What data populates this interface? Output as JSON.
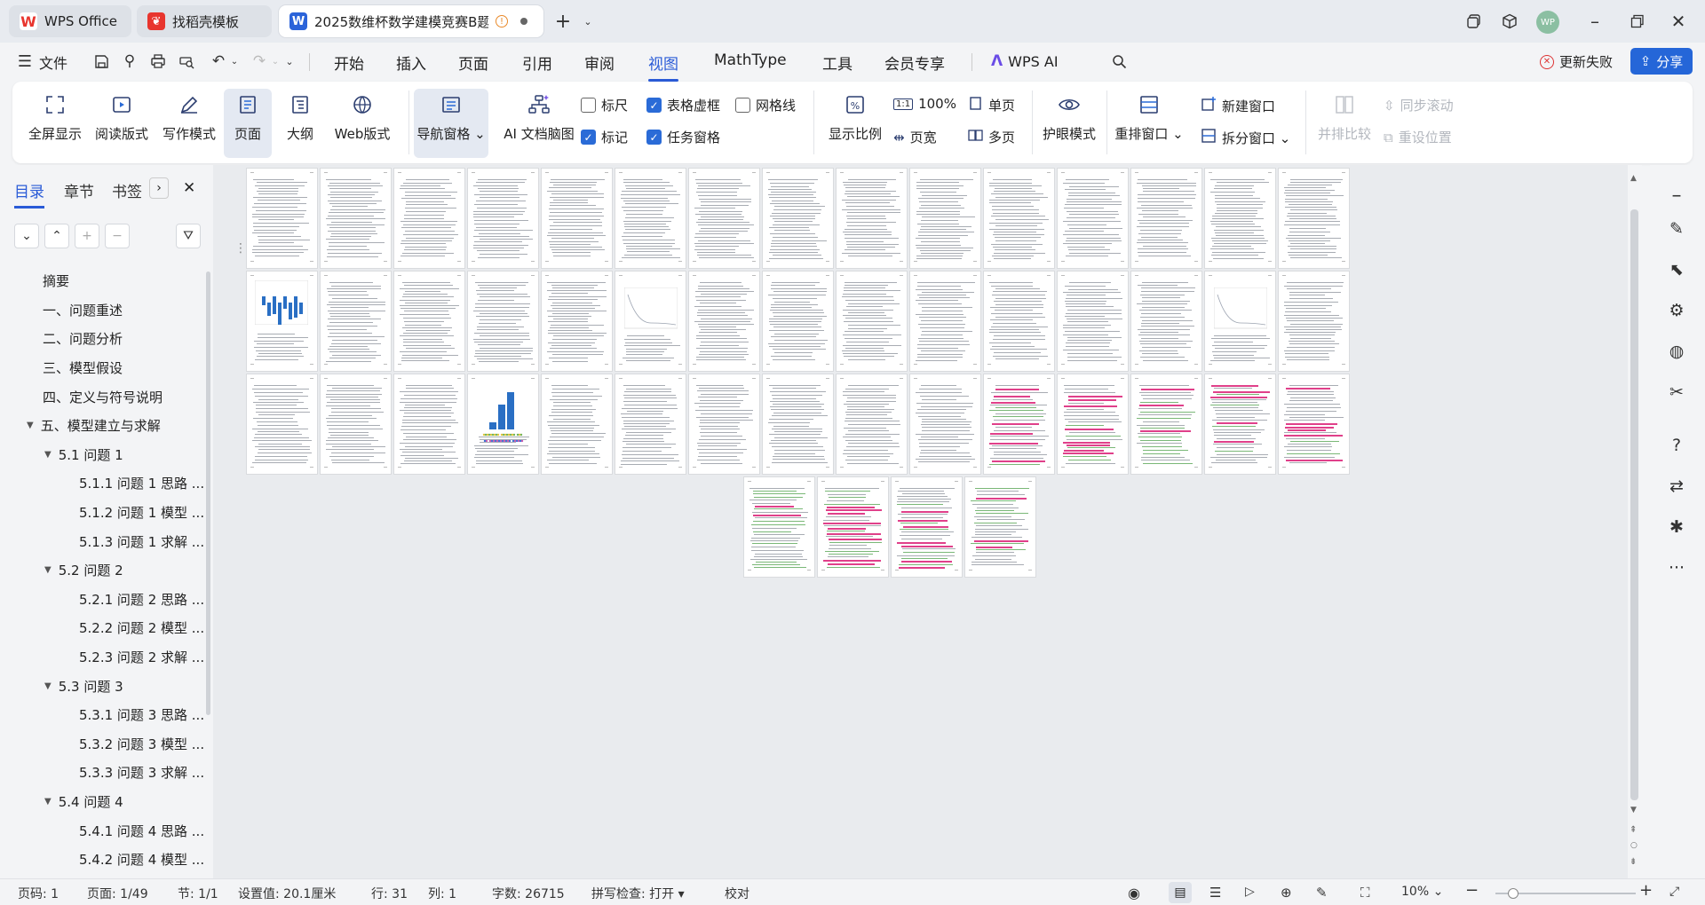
{
  "tabs": {
    "wps_office": "WPS Office",
    "template": "找稻壳模板",
    "document": "2025数维杯数学建模竞赛B题",
    "avatar": "WP"
  },
  "menu": {
    "file": "文件",
    "items": [
      "开始",
      "插入",
      "页面",
      "引用",
      "审阅",
      "视图",
      "MathType",
      "工具",
      "会员专享"
    ],
    "wps_ai": "WPS AI",
    "update_failed": "更新失败",
    "share": "分享"
  },
  "ribbon": {
    "fullscreen": "全屏显示",
    "reading": "阅读版式",
    "writing": "写作模式",
    "page": "页面",
    "outline": "大纲",
    "web": "Web版式",
    "nav_pane": "导航窗格",
    "ai_map": "AI 文档脑图",
    "ruler": "标尺",
    "table_gridlines": "表格虚框",
    "gridlines": "网格线",
    "marks": "标记",
    "task_pane": "任务窗格",
    "zoom_ratio": "显示比例",
    "zoom_100": "100%",
    "page_width": "页宽",
    "single_page": "单页",
    "multi_page": "多页",
    "eye_mode": "护眼模式",
    "rearrange": "重排窗口",
    "new_window": "新建窗口",
    "split_window": "拆分窗口",
    "side_by_side": "并排比较",
    "sync_scroll": "同步滚动",
    "reset_position": "重设位置"
  },
  "checkboxes": {
    "ruler": false,
    "table_gridlines": true,
    "gridlines": false,
    "marks": true,
    "task_pane": true
  },
  "sidebar": {
    "tabs": [
      "目录",
      "章节",
      "书签"
    ],
    "outline": [
      "摘要",
      "一、问题重述",
      "二、问题分析",
      "三、模型假设",
      "四、定义与符号说明",
      "五、模型建立与求解",
      "5.1 问题 1",
      "5.1.1 问题 1 思路 ...",
      "5.1.2 问题 1 模型 ...",
      "5.1.3 问题 1 求解 ...",
      "5.2 问题 2",
      "5.2.1 问题 2 思路 ...",
      "5.2.2 问题 2 模型 ...",
      "5.2.3 问题 2 求解 ...",
      "5.3 问题 3",
      "5.3.1 问题 3 思路 ...",
      "5.3.2 问题 3 模型 ...",
      "5.3.3 问题 3 求解 ...",
      "5.4 问题 4",
      "5.4.1 问题 4 思路 ...",
      "5.4.2 问题 4 模型 ..."
    ]
  },
  "status": {
    "page_num": "页码: 1",
    "page": "页面: 1/49",
    "section": "节: 1/1",
    "setting": "设置值: 20.1厘米",
    "row": "行: 31",
    "col": "列: 1",
    "words": "字数: 26715",
    "spell": "拼写检查: 打开",
    "proof": "校对",
    "zoom": "10%"
  },
  "colors": {
    "accent": "#2a5bd7",
    "wps_red": "#e8352e",
    "word_blue": "#2b63d9",
    "share_bg": "#2566d8",
    "avatar_bg": "#8bbfa2"
  }
}
